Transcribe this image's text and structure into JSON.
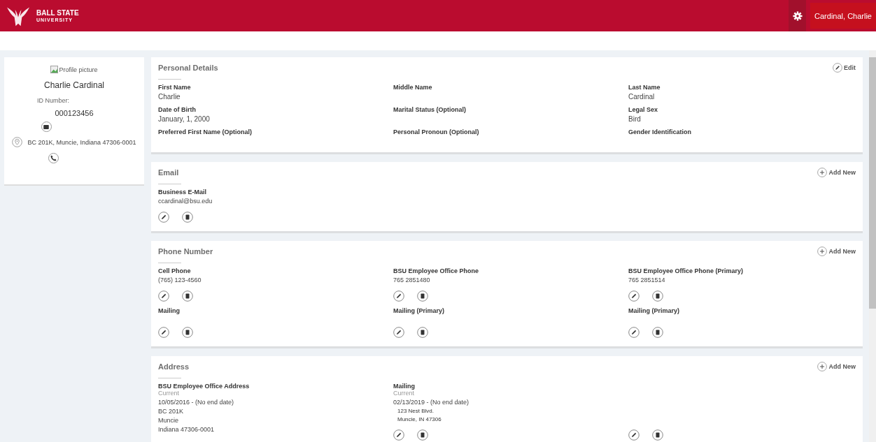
{
  "header": {
    "logo_line1": "BALL STATE",
    "logo_line2": "UNIVERSITY",
    "user": "Cardinal, Charlie"
  },
  "profile": {
    "picture_alt": "Profile picture",
    "name": "Charlie Cardinal",
    "id_label": "ID Number:",
    "id": "000123456",
    "address": "BC 201K, Muncie, Indiana 47306-0001"
  },
  "sections": [
    {
      "kind": "details",
      "title": "Personal Details",
      "action": {
        "kind": "edit",
        "label": "Edit"
      },
      "items": [
        {
          "label": "First Name",
          "lines": [
            "Charlie"
          ]
        },
        {
          "label": "Middle Name"
        },
        {
          "label": "Last Name",
          "lines": [
            "Cardinal"
          ]
        },
        {
          "label": "Date of Birth",
          "lines": [
            "January, 1, 2000"
          ]
        },
        {
          "label": "Marital Status (Optional)"
        },
        {
          "label": "Legal Sex",
          "lines": [
            "Bird"
          ]
        },
        {
          "label": "Preferred First Name (Optional)"
        },
        {
          "label": "Personal Pronoun (Optional)"
        },
        {
          "label": "Gender Identification"
        }
      ]
    },
    {
      "kind": "records",
      "title": "Email",
      "action": {
        "kind": "add",
        "label": "Add New"
      },
      "items": [
        {
          "label": "Business E-Mail",
          "lines": [
            "ccardinal@bsu.edu"
          ]
        }
      ]
    },
    {
      "kind": "records",
      "title": "Phone Number",
      "action": {
        "kind": "add",
        "label": "Add New"
      },
      "items": [
        {
          "label": "Cell Phone",
          "lines": [
            "(765) 123-4560"
          ]
        },
        {
          "label": "BSU Employee Office Phone",
          "lines": [
            "765 2851480"
          ]
        },
        {
          "label": "BSU Employee Office Phone (Primary)",
          "lines": [
            "765 2851514"
          ]
        },
        {
          "label": "Mailing"
        },
        {
          "label": "Mailing (Primary)"
        },
        {
          "label": "Mailing (Primary)"
        }
      ]
    },
    {
      "kind": "records",
      "title": "Address",
      "action": {
        "kind": "add",
        "label": "Add New"
      },
      "items": [
        {
          "label": "BSU Employee Office Address",
          "status": "Current",
          "lines": [
            "10/05/2016 - (No end date)",
            "BC 201K",
            "Muncie",
            "Indiana 47306-0001"
          ],
          "actions": false
        },
        {
          "label": "Mailing",
          "status": "Current",
          "lines": [
            "02/13/2019 - (No end date)"
          ],
          "sublines": [
            "123 Nest Blvd.",
            "Muncie, IN 47306"
          ],
          "actions": true
        },
        {
          "actions": true
        }
      ]
    }
  ]
}
